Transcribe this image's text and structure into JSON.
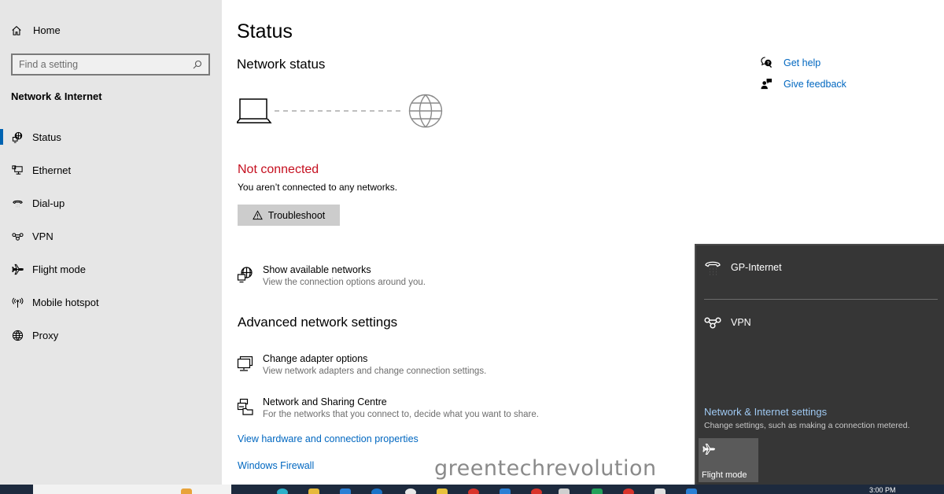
{
  "sidebar": {
    "home_label": "Home",
    "search_placeholder": "Find a setting",
    "section_title": "Network & Internet",
    "items": [
      {
        "label": "Status",
        "icon": "status-globe-icon",
        "active": true
      },
      {
        "label": "Ethernet",
        "icon": "ethernet-icon"
      },
      {
        "label": "Dial-up",
        "icon": "dial-up-icon"
      },
      {
        "label": "VPN",
        "icon": "vpn-icon"
      },
      {
        "label": "Flight mode",
        "icon": "airplane-icon"
      },
      {
        "label": "Mobile hotspot",
        "icon": "hotspot-icon"
      },
      {
        "label": "Proxy",
        "icon": "globe-icon"
      }
    ]
  },
  "main": {
    "title": "Status",
    "network_status_heading": "Network status",
    "connection_state": "Not connected",
    "connection_desc": "You aren’t connected to any networks.",
    "troubleshoot_label": "Troubleshoot",
    "show_networks": {
      "title": "Show available networks",
      "desc": "View the connection options around you."
    },
    "advanced_heading": "Advanced network settings",
    "adapter": {
      "title": "Change adapter options",
      "desc": "View network adapters and change connection settings."
    },
    "sharing": {
      "title": "Network and Sharing Centre",
      "desc": "For the networks that you connect to, decide what you want to share."
    },
    "links": [
      "View hardware and connection properties",
      "Windows Firewall"
    ]
  },
  "help": {
    "get_help": "Get help",
    "give_feedback": "Give feedback"
  },
  "flyout": {
    "connection_name": "GP-Internet",
    "vpn_label": "VPN",
    "settings_link": "Network & Internet settings",
    "settings_desc": "Change settings, such as making a connection metered.",
    "flight_mode_label": "Flight mode"
  },
  "taskbar": {
    "time": "3:00 PM"
  },
  "watermark": "greentechrevolution",
  "colors": {
    "accent": "#0063b1",
    "link": "#0067c0",
    "error": "#c50f1f",
    "flyout_bg": "#363636"
  }
}
